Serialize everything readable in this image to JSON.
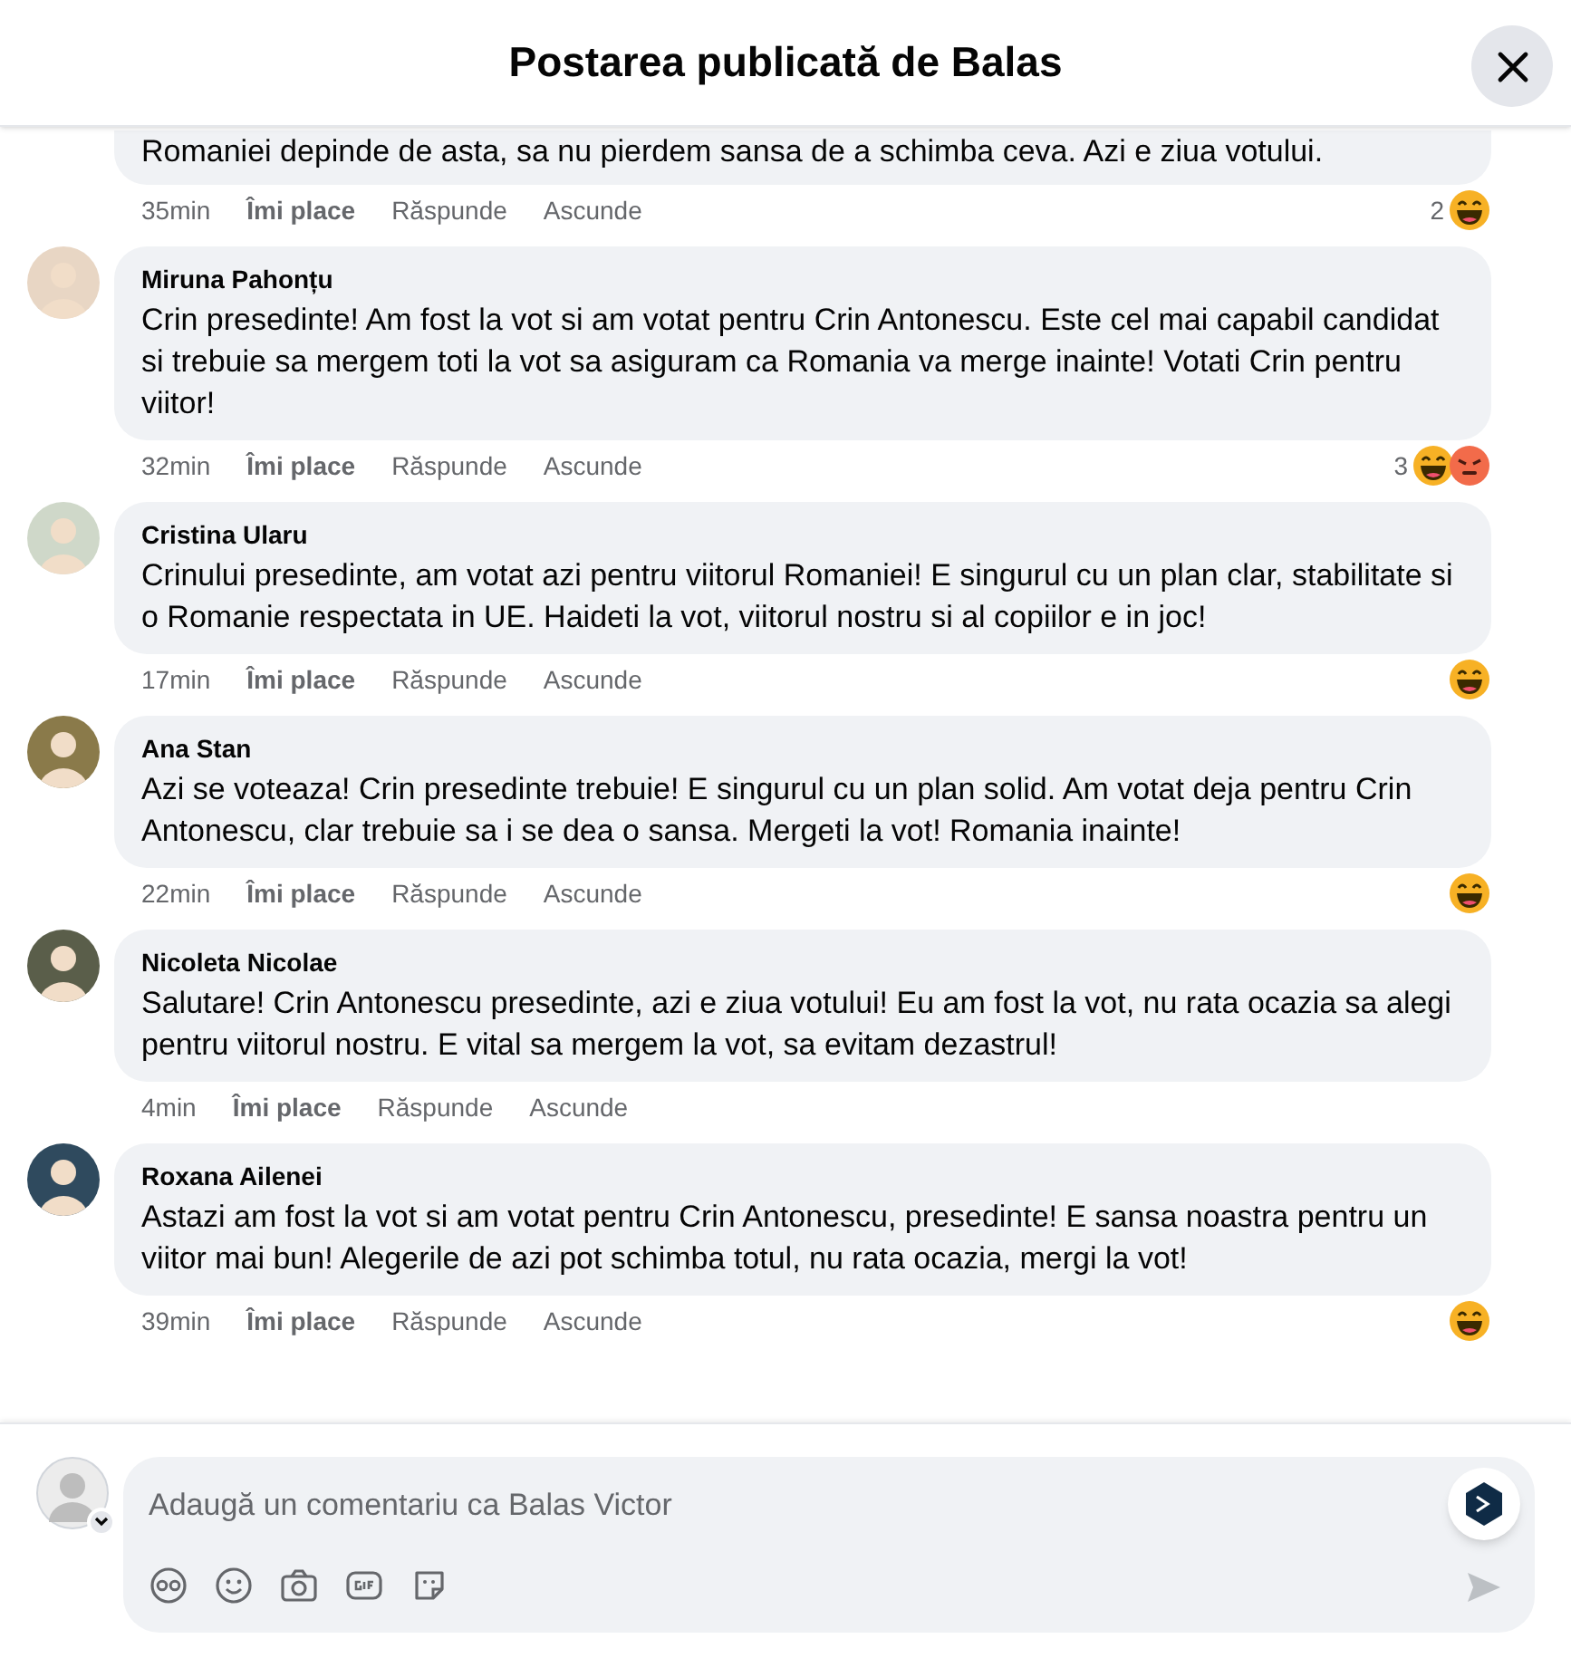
{
  "dialog": {
    "title": "Postarea publicată de Balas"
  },
  "comments": [
    {
      "text": "Romaniei depinde de asta, sa nu pierdem sansa de a schimba ceva. Azi e ziua votului.",
      "time": "35min",
      "like": "Îmi place",
      "reply": "Răspunde",
      "hide": "Ascunde",
      "reaction_count": "2",
      "reactions": [
        {
          "kind": "haha"
        }
      ]
    },
    {
      "author": "Miruna Pahonțu",
      "text": "Crin presedinte! Am fost la vot si am votat pentru Crin Antonescu. Este cel mai capabil candidat si trebuie sa mergem toti la vot sa asiguram ca Romania va merge inainte! Votati Crin pentru viitor!",
      "time": "32min",
      "like": "Îmi place",
      "reply": "Răspunde",
      "hide": "Ascunde",
      "reaction_count": "3",
      "reactions": [
        {
          "kind": "haha"
        },
        {
          "kind": "angry"
        }
      ]
    },
    {
      "author": "Cristina Ularu",
      "text": "Crinului presedinte, am votat azi pentru viitorul Romaniei! E singurul cu un plan clar, stabilitate si o Romanie respectata in UE. Haideti la vot, viitorul nostru si al copiilor e in joc!",
      "time": "17min",
      "like": "Îmi place",
      "reply": "Răspunde",
      "hide": "Ascunde",
      "reactions": [
        {
          "kind": "haha"
        }
      ]
    },
    {
      "author": "Ana Stan",
      "text": "Azi se voteaza! Crin presedinte trebuie! E singurul cu un plan solid. Am votat deja pentru Crin Antonescu, clar trebuie sa i se dea o sansa. Mergeti la vot! Romania inainte!",
      "time": "22min",
      "like": "Îmi place",
      "reply": "Răspunde",
      "hide": "Ascunde",
      "reactions": [
        {
          "kind": "haha"
        }
      ]
    },
    {
      "author": "Nicoleta Nicolae",
      "text": "Salutare! Crin Antonescu presedinte, azi e ziua votului! Eu am fost la vot, nu rata ocazia sa alegi pentru viitorul nostru. E vital sa mergem la vot, sa evitam dezastrul!",
      "time": "4min",
      "like": "Îmi place",
      "reply": "Răspunde",
      "hide": "Ascunde"
    },
    {
      "author": "Roxana Ailenei",
      "text": "Astazi am fost la vot si am votat pentru Crin Antonescu, presedinte! E sansa noastra pentru un viitor mai bun! Alegerile de azi pot schimba totul, nu rata ocazia, mergi la vot!",
      "time": "39min",
      "like": "Îmi place",
      "reply": "Răspunde",
      "hide": "Ascunde",
      "reactions": [
        {
          "kind": "haha"
        }
      ]
    }
  ],
  "composer": {
    "placeholder": "Adaugă un comentariu ca Balas Victor"
  }
}
